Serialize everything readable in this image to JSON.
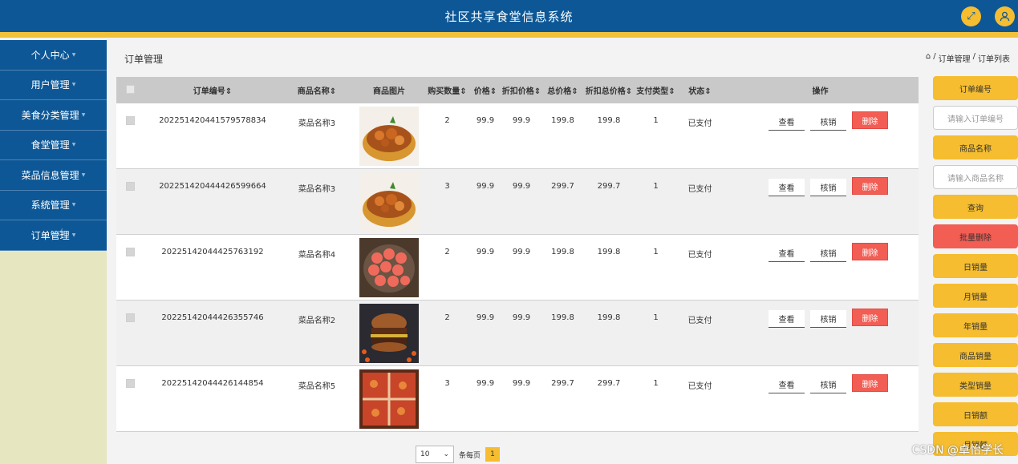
{
  "header": {
    "title": "社区共享食堂信息系统",
    "fullscreen_icon": "expand-icon",
    "user_icon": "user-icon"
  },
  "sidebar": {
    "items": [
      {
        "label": "个人中心"
      },
      {
        "label": "用户管理"
      },
      {
        "label": "美食分类管理"
      },
      {
        "label": "食堂管理"
      },
      {
        "label": "菜品信息管理"
      },
      {
        "label": "系统管理"
      },
      {
        "label": "订单管理"
      }
    ]
  },
  "page": {
    "title": "订单管理",
    "breadcrumb": [
      "订单管理",
      "订单列表"
    ]
  },
  "table": {
    "headers": {
      "order_no": "订单编号",
      "name": "商品名称",
      "image": "商品图片",
      "qty": "购买数量",
      "price": "价格",
      "discount_price": "折扣价格",
      "total": "总价格",
      "discount_total": "折扣总价格",
      "pay_type": "支付类型",
      "status": "状态",
      "ops": "操作"
    },
    "rows": [
      {
        "order_no": "202251420441579578834",
        "name": "菜品名称3",
        "qty": "2",
        "price": "99.9",
        "discount_price": "99.9",
        "total": "199.8",
        "discount_total": "199.8",
        "pay_type": "1",
        "status": "已支付",
        "image_kind": "stew"
      },
      {
        "order_no": "202251420444426599664",
        "name": "菜品名称3",
        "qty": "3",
        "price": "99.9",
        "discount_price": "99.9",
        "total": "299.7",
        "discount_total": "299.7",
        "pay_type": "1",
        "status": "已支付",
        "image_kind": "stew"
      },
      {
        "order_no": "20225142044425763192",
        "name": "菜品名称4",
        "qty": "2",
        "price": "99.9",
        "discount_price": "99.9",
        "total": "199.8",
        "discount_total": "199.8",
        "pay_type": "1",
        "status": "已支付",
        "image_kind": "tomato"
      },
      {
        "order_no": "20225142044426355746",
        "name": "菜品名称2",
        "qty": "2",
        "price": "99.9",
        "discount_price": "99.9",
        "total": "199.8",
        "discount_total": "199.8",
        "pay_type": "1",
        "status": "已支付",
        "image_kind": "burger"
      },
      {
        "order_no": "20225142044426144854",
        "name": "菜品名称5",
        "qty": "3",
        "price": "99.9",
        "discount_price": "99.9",
        "total": "299.7",
        "discount_total": "299.7",
        "pay_type": "1",
        "status": "已支付",
        "image_kind": "hotpot"
      }
    ],
    "actions": {
      "view": "查看",
      "verify": "核销",
      "delete": "删除"
    }
  },
  "pager": {
    "page_size": "10",
    "per_page_label": "条每页",
    "current_page": "1"
  },
  "right_panel": {
    "order_no_label": "订单编号",
    "order_no_placeholder": "请输入订单编号",
    "name_label": "商品名称",
    "name_placeholder": "请输入商品名称",
    "query": "查询",
    "batch_delete": "批量删除",
    "stats": [
      "日销量",
      "月销量",
      "年销量",
      "商品销量",
      "类型销量",
      "日销额",
      "月销额"
    ]
  },
  "watermark": "CSDN @卓怡学长",
  "colors": {
    "header": "#0d5796",
    "accent": "#f5bd2f",
    "danger": "#f25d54"
  }
}
